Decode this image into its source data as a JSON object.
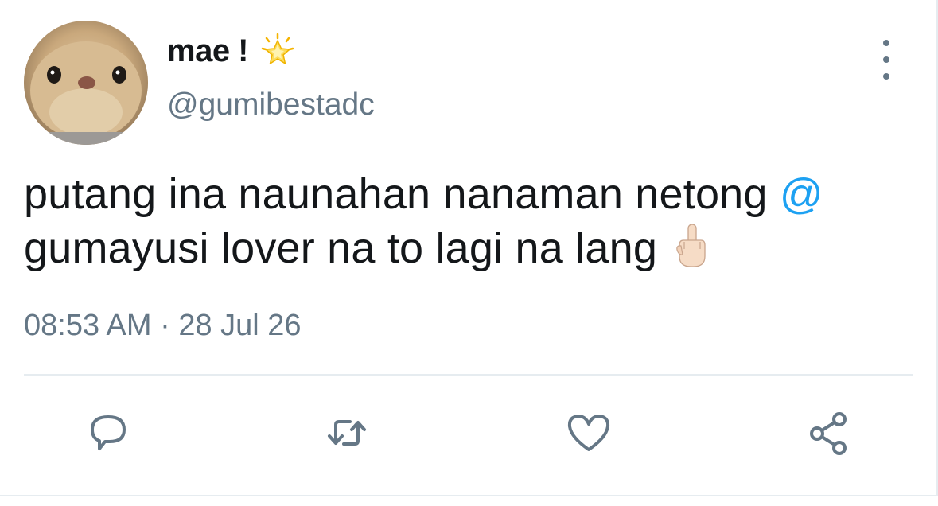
{
  "author": {
    "display_name": "mae !",
    "handle": "@gumibestadc",
    "badge_emoji_name": "glowing-star"
  },
  "tweet": {
    "line1": "putang ina naunahan nanaman netong ",
    "mention": "@",
    "line2": "gumayusi lover na to lagi na lang",
    "trailing_emoji_name": "middle-finger-light-skin"
  },
  "timestamp": "08:53 AM · 28 Jul 26",
  "actions": {
    "reply_icon": "comment-icon",
    "retweet_icon": "retweet-icon",
    "like_icon": "heart-icon",
    "share_icon": "share-icon"
  },
  "colors": {
    "text": "#14171a",
    "secondary": "#657786",
    "accent": "#1da1f2",
    "divider": "#e6ecf0"
  }
}
